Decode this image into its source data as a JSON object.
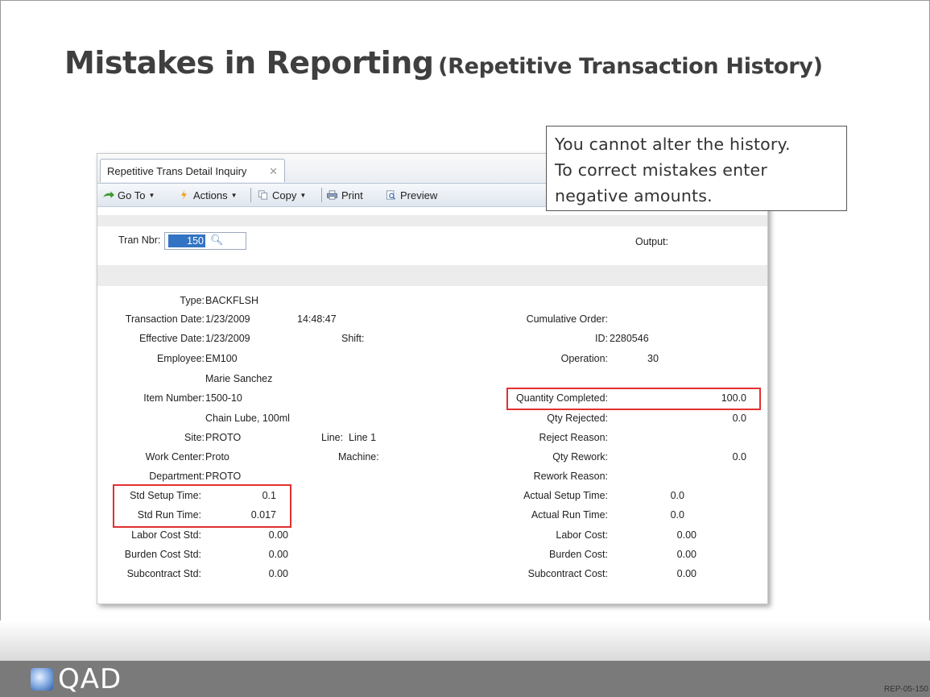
{
  "slide": {
    "title_main": "Mistakes in Reporting",
    "title_sub": "(Repetitive Transaction History)",
    "callout_lines": [
      "You cannot alter the history.",
      "To correct mistakes enter",
      "negative amounts."
    ],
    "brand": "QAD",
    "slide_id": "REP-05-150"
  },
  "window": {
    "tab_label": "Repetitive Trans Detail Inquiry",
    "toolbar": {
      "goto": "Go To",
      "actions": "Actions",
      "copy": "Copy",
      "print": "Print",
      "preview": "Preview"
    }
  },
  "form": {
    "tran_nbr_label": "Tran Nbr:",
    "tran_nbr_value": "150",
    "output_label": "Output:",
    "type_label": "Type:",
    "type_value": "BACKFLSH",
    "trans_date_label": "Transaction Date:",
    "trans_date_value": "1/23/2009",
    "trans_time": "14:48:47",
    "eff_date_label": "Effective Date:",
    "eff_date_value": "1/23/2009",
    "shift_label": "Shift:",
    "employee_label": "Employee:",
    "employee_value": "EM100",
    "employee_name": "Marie Sanchez",
    "item_label": "Item Number:",
    "item_value": "1500-10",
    "item_desc": "Chain Lube, 100ml",
    "site_label": "Site:",
    "site_value": "PROTO",
    "line_label": "Line:",
    "line_value": "Line 1",
    "wc_label": "Work Center:",
    "wc_value": "Proto",
    "machine_label": "Machine:",
    "dept_label": "Department:",
    "dept_value": "PROTO",
    "setup_std_label": "Std Setup Time:",
    "setup_std_value": "0.1",
    "run_std_label": "Std Run Time:",
    "run_std_value": "0.017",
    "labor_std_label": "Labor Cost Std:",
    "labor_std_value": "0.00",
    "burden_std_label": "Burden Cost Std:",
    "burden_std_value": "0.00",
    "sub_std_label": "Subcontract Std:",
    "sub_std_value": "0.00",
    "cum_order_label": "Cumulative Order:",
    "id_label": "ID:",
    "id_value": "2280546",
    "operation_label": "Operation:",
    "operation_value": "30",
    "qty_completed_label": "Quantity Completed:",
    "qty_completed_value": "100.0",
    "qty_rejected_label": "Qty Rejected:",
    "qty_rejected_value": "0.0",
    "reject_reason_label": "Reject Reason:",
    "qty_rework_label": "Qty Rework:",
    "qty_rework_value": "0.0",
    "rework_reason_label": "Rework Reason:",
    "actual_setup_label": "Actual Setup Time:",
    "actual_setup_value": "0.0",
    "actual_run_label": "Actual Run Time:",
    "actual_run_value": "0.0",
    "labor_cost_label": "Labor Cost:",
    "labor_cost_value": "0.00",
    "burden_cost_label": "Burden Cost:",
    "burden_cost_value": "0.00",
    "sub_cost_label": "Subcontract Cost:",
    "sub_cost_value": "0.00"
  },
  "colors": {
    "highlight": "#e23030",
    "selection": "#3373c4"
  }
}
